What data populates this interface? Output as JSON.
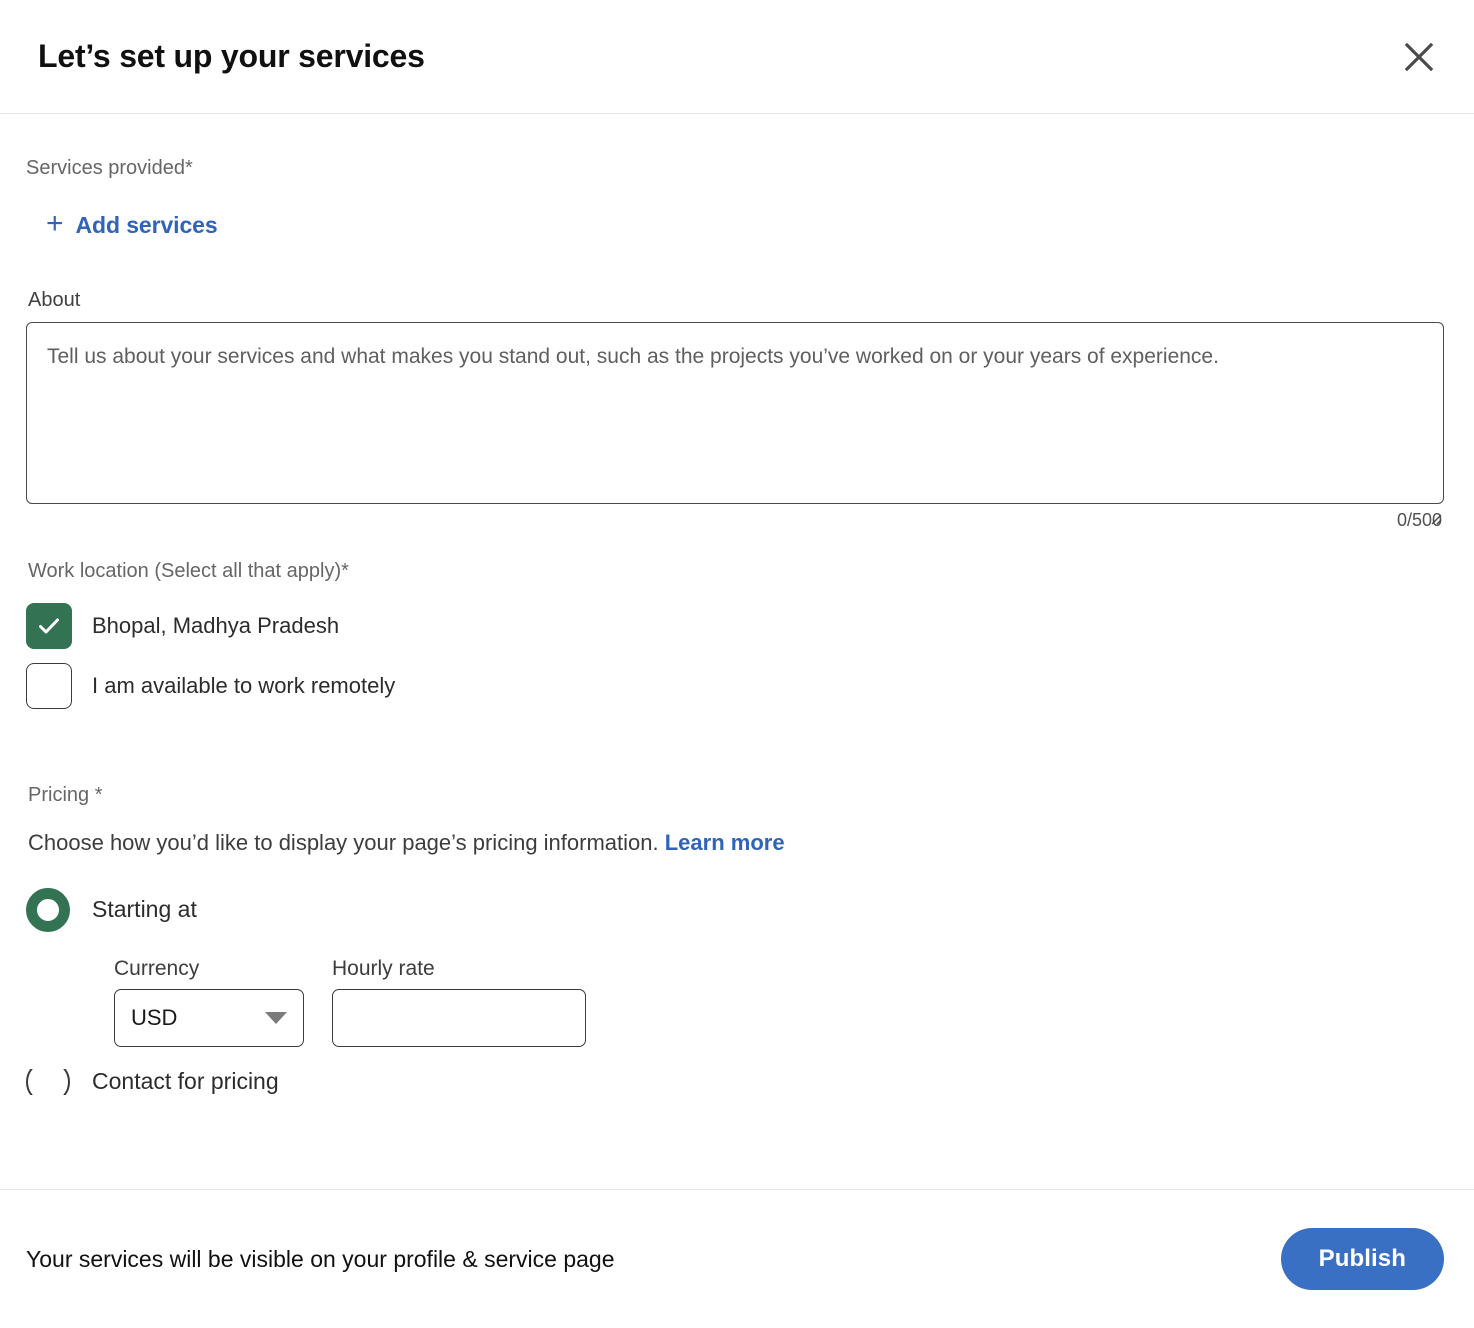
{
  "header": {
    "title": "Let’s set up your services",
    "close_icon": "close-icon"
  },
  "form": {
    "services": {
      "label": "Services provided*",
      "add_button_plus": "+",
      "add_button_label": "Add services"
    },
    "about": {
      "label": "About",
      "placeholder": "Tell us about your services and what makes you stand out, such as the projects you’ve worked on or your years of experience.",
      "value": "",
      "char_count": "0/500"
    },
    "work_location": {
      "label": "Work location (Select all that apply)*",
      "options": [
        {
          "label": "Bhopal, Madhya Pradesh",
          "checked": true
        },
        {
          "label": "I am available to work remotely",
          "checked": false
        }
      ]
    },
    "pricing": {
      "label": "Pricing *",
      "description": "Choose how you’d like to display your page’s pricing information.",
      "learn_more": "Learn more",
      "options": [
        {
          "label": "Starting at",
          "selected": true
        },
        {
          "label": "Contact for pricing",
          "selected": false
        }
      ],
      "currency": {
        "label": "Currency",
        "value": "USD",
        "caret_icon": "chevron-down-icon"
      },
      "hourly_rate": {
        "label": "Hourly rate",
        "value": "",
        "placeholder": ""
      }
    }
  },
  "footer": {
    "note": "Your services will be visible on your profile & service page",
    "publish_label": "Publish"
  },
  "colors": {
    "accent_blue": "#2f64b8",
    "button_blue": "#3a70c4",
    "selected_green": "#337354",
    "text_dark": "#191919",
    "text_muted": "#666666",
    "divider": "#e6e6e6"
  }
}
